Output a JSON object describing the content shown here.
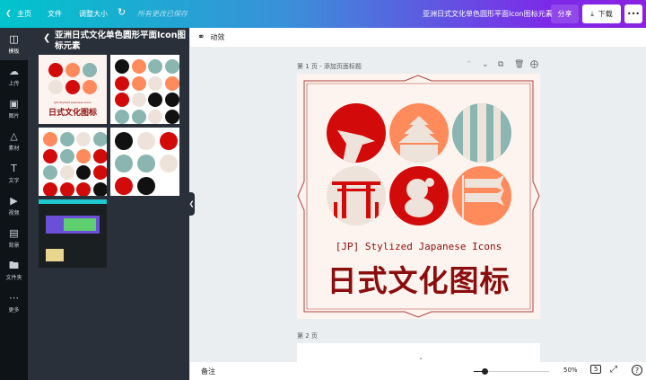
{
  "topbar": {
    "home": "主页",
    "file": "文件",
    "resize": "调整大小",
    "saved": "所有更改已保存",
    "doc_title": "亚洲日式文化单色圆形平面Icon图标元素",
    "share": "分享",
    "download": "下载",
    "more": "•••"
  },
  "rail": [
    {
      "label": "模板",
      "icon": "template-icon"
    },
    {
      "label": "上传",
      "icon": "upload-icon"
    },
    {
      "label": "图片",
      "icon": "image-icon"
    },
    {
      "label": "素材",
      "icon": "elements-icon"
    },
    {
      "label": "文字",
      "icon": "text-icon"
    },
    {
      "label": "视频",
      "icon": "video-icon"
    },
    {
      "label": "背景",
      "icon": "background-icon"
    },
    {
      "label": "文件夹",
      "icon": "folder-icon"
    },
    {
      "label": "更多",
      "icon": "more-icon"
    }
  ],
  "panel": {
    "title": "亚洲日式文化单色圆形平面Icon图标元素",
    "thumb1_sub": "[JP] Stylized Japanese Icons",
    "thumb1_title": "日式文化图标"
  },
  "toolbar": {
    "animate": "动效"
  },
  "page1": {
    "label": "第 1 页 - 添加页面标题",
    "subtitle": "[JP] Stylized Japanese Icons",
    "title": "日式文化图标"
  },
  "page2": {
    "label": "第 2 页"
  },
  "bottom": {
    "notes": "备注",
    "zoom": "50%",
    "page_count": "5",
    "help": "?"
  },
  "colors": {
    "red": "#d20a0a",
    "orange": "#ff8a5c",
    "teal": "#8ab5b0",
    "beige": "#ede3da",
    "title": "#8b0e0e"
  }
}
